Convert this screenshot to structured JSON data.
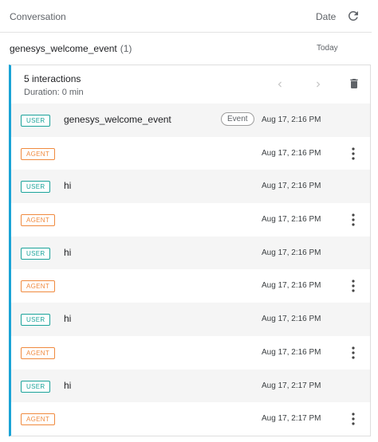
{
  "header": {
    "conversation_label": "Conversation",
    "date_label": "Date"
  },
  "conversation": {
    "name": "genesys_welcome_event",
    "count": "(1)",
    "date": "Today"
  },
  "panel": {
    "interactions": "5 interactions",
    "duration": "Duration: 0 min",
    "accent_color": "#1aa3d6"
  },
  "rows": [
    {
      "role": "USER",
      "message": "genesys_welcome_event",
      "chip": "Event",
      "time": "Aug 17, 2:16 PM",
      "menu": false
    },
    {
      "role": "AGENT",
      "message": "",
      "time": "Aug 17, 2:16 PM",
      "menu": true
    },
    {
      "role": "USER",
      "message": "hi",
      "time": "Aug 17, 2:16 PM",
      "menu": false
    },
    {
      "role": "AGENT",
      "message": "",
      "time": "Aug 17, 2:16 PM",
      "menu": true
    },
    {
      "role": "USER",
      "message": "hi",
      "time": "Aug 17, 2:16 PM",
      "menu": false
    },
    {
      "role": "AGENT",
      "message": "",
      "time": "Aug 17, 2:16 PM",
      "menu": true
    },
    {
      "role": "USER",
      "message": "hi",
      "time": "Aug 17, 2:16 PM",
      "menu": false
    },
    {
      "role": "AGENT",
      "message": "",
      "time": "Aug 17, 2:16 PM",
      "menu": true
    },
    {
      "role": "USER",
      "message": "hi",
      "time": "Aug 17, 2:17 PM",
      "menu": false
    },
    {
      "role": "AGENT",
      "message": "",
      "time": "Aug 17, 2:17 PM",
      "menu": true
    }
  ]
}
